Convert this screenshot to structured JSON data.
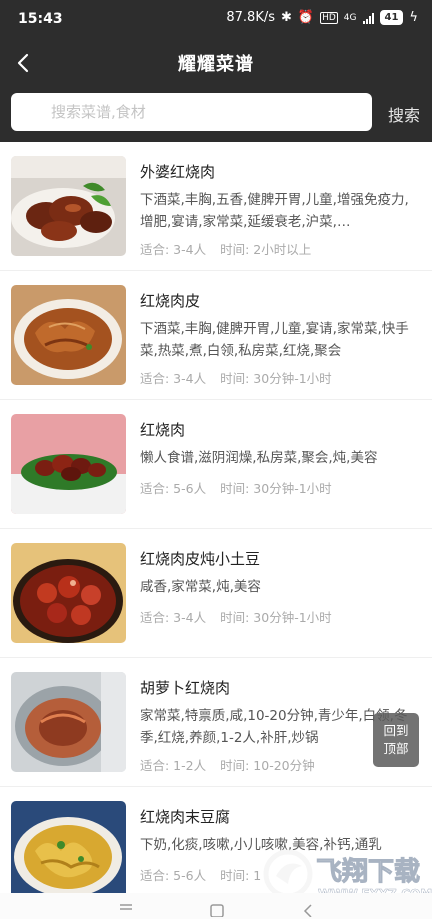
{
  "status": {
    "time": "15:43",
    "speed": "87.8K/s",
    "battery": "41",
    "net": "4G"
  },
  "header": {
    "title": "耀耀菜谱",
    "search_placeholder": "搜索菜谱,食材",
    "search_button": "搜索"
  },
  "meta_labels": {
    "serves": "适合:",
    "time": "时间:"
  },
  "recipes": [
    {
      "name": "外婆红烧肉",
      "tags": "下酒菜,丰胸,五香,健脾开胃,儿童,增强免疫力,增肥,宴请,家常菜,延缓衰老,沪菜,…",
      "serves": "适合: 3-4人",
      "time": "时间: 2小时以上"
    },
    {
      "name": "红烧肉皮",
      "tags": "下酒菜,丰胸,健脾开胃,儿童,宴请,家常菜,快手菜,热菜,煮,白领,私房菜,红烧,聚会",
      "serves": "适合: 3-4人",
      "time": "时间: 30分钟-1小时"
    },
    {
      "name": "红烧肉",
      "tags": "懒人食谱,滋阴润燥,私房菜,聚会,炖,美容",
      "serves": "适合: 5-6人",
      "time": "时间: 30分钟-1小时"
    },
    {
      "name": "红烧肉皮炖小土豆",
      "tags": "咸香,家常菜,炖,美容",
      "serves": "适合: 3-4人",
      "time": "时间: 30分钟-1小时"
    },
    {
      "name": "胡萝卜红烧肉",
      "tags": "家常菜,特禀质,咸,10-20分钟,青少年,白领,冬季,红烧,养颜,1-2人,补肝,炒锅",
      "serves": "适合: 1-2人",
      "time": "时间: 10-20分钟"
    },
    {
      "name": "红烧肉末豆腐",
      "tags": "下奶,化痰,咳嗽,小儿咳嗽,美容,补钙,通乳",
      "serves": "适合: 5-6人",
      "time": "时间: 1"
    }
  ],
  "to_top": {
    "line1": "回到",
    "line2": "顶部"
  },
  "watermark": {
    "text": "飞翔下载",
    "url": "WWW.FXXZ.COM"
  },
  "colors": {
    "header_bg": "#2d2d2d",
    "accent": "#e0443a"
  }
}
